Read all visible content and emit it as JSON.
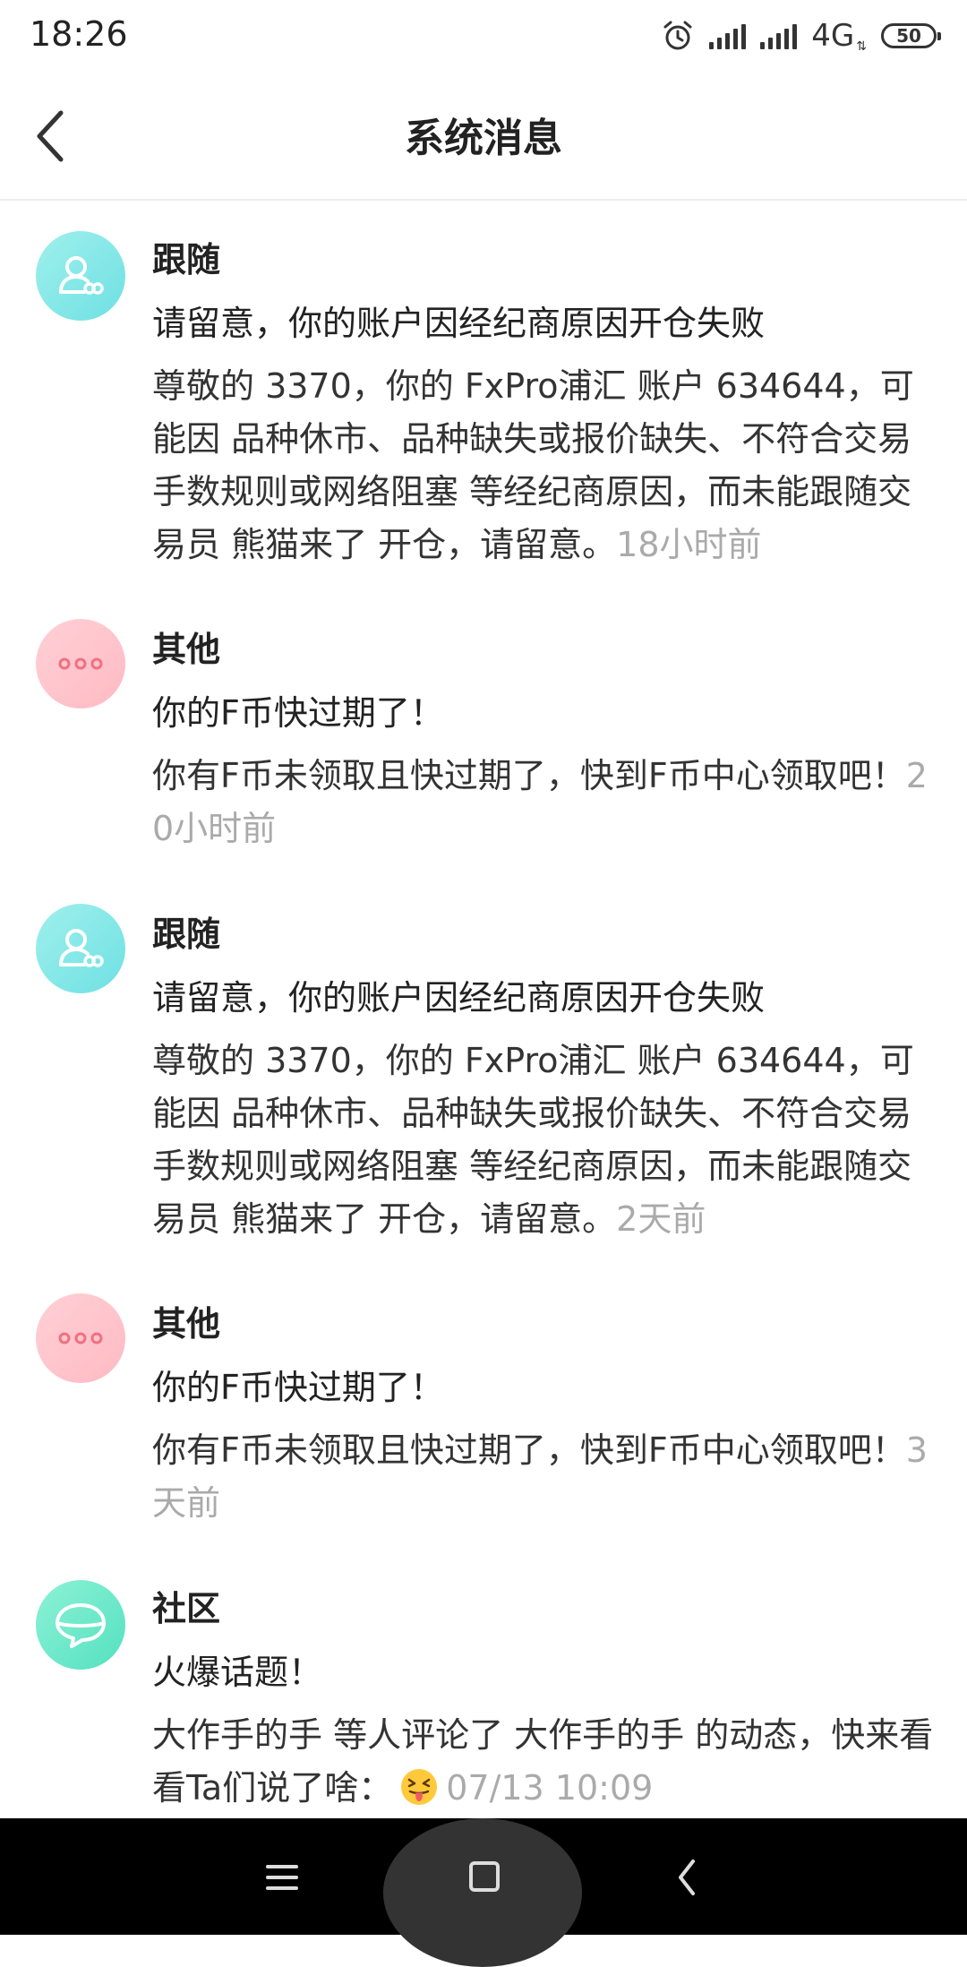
{
  "status_bar": {
    "time": "18:26",
    "network": "4G",
    "battery": "50"
  },
  "header": {
    "title": "系统消息"
  },
  "messages": [
    {
      "category": "跟随",
      "icon": "follow-users-icon",
      "subject": "请留意，你的账户因经纪商原因开仓失败",
      "content": "尊敬的 3370，你的 FxPro浦汇 账户 634644，可能因 品种休市、品种缺失或报价缺失、不符合交易手数规则或网络阻塞 等经纪商原因，而未能跟随交易员 熊猫来了 开仓，请留意。",
      "time": "18小时前"
    },
    {
      "category": "其他",
      "icon": "more-dots-icon",
      "subject": "你的F币快过期了！",
      "content": "你有F币未领取且快过期了，快到F币中心领取吧！",
      "time": "20小时前"
    },
    {
      "category": "跟随",
      "icon": "follow-users-icon",
      "subject": "请留意，你的账户因经纪商原因开仓失败",
      "content": "尊敬的 3370，你的 FxPro浦汇 账户 634644，可能因 品种休市、品种缺失或报价缺失、不符合交易手数规则或网络阻塞 等经纪商原因，而未能跟随交易员 熊猫来了 开仓，请留意。",
      "time": "2天前"
    },
    {
      "category": "其他",
      "icon": "more-dots-icon",
      "subject": "你的F币快过期了！",
      "content": "你有F币未领取且快过期了，快到F币中心领取吧！",
      "time": "3天前"
    },
    {
      "category": "社区",
      "icon": "chat-bubble-icon",
      "subject": "火爆话题！",
      "content": " 大作手的手 等人评论了 大作手的手 的动态，快来看看Ta们说了啥：",
      "emoji": "tongue-out-emoji",
      "time": "07/13 10:09"
    }
  ],
  "colors": {
    "follow_avatar": "#7de6e6",
    "other_avatar": "#ffc4cc",
    "community_avatar": "#6ee8c9",
    "time_text": "#aaaaaa"
  }
}
